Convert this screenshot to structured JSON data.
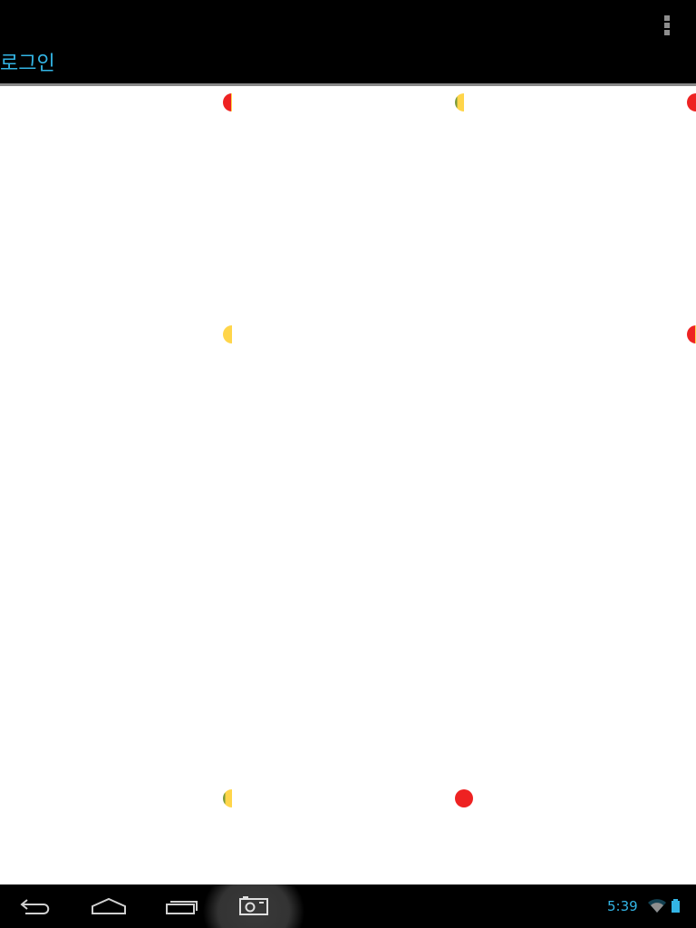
{
  "action_bar": {
    "title": "로그인",
    "overflow_icon": "overflow-menu-icon"
  },
  "content": {
    "colors": {
      "red": "#ee2222",
      "yellow": "#ffd54a"
    },
    "markers": [
      {
        "name": "marker-top-left",
        "style": "split-red-yellow"
      },
      {
        "name": "marker-top-center",
        "style": "yellow-partial"
      },
      {
        "name": "marker-top-right",
        "style": "red"
      },
      {
        "name": "marker-middle-left",
        "style": "yellow"
      },
      {
        "name": "marker-middle-center",
        "style": "yellow-half"
      },
      {
        "name": "marker-middle-right",
        "style": "split-red-yellow"
      },
      {
        "name": "marker-bottom-left",
        "style": "yellow-partial"
      },
      {
        "name": "marker-bottom-center",
        "style": "red"
      }
    ]
  },
  "nav_bar": {
    "buttons": [
      {
        "name": "back-button",
        "icon": "back-icon"
      },
      {
        "name": "home-button",
        "icon": "home-icon"
      },
      {
        "name": "recent-apps-button",
        "icon": "recent-apps-icon"
      },
      {
        "name": "screenshot-button",
        "icon": "camera-icon"
      }
    ],
    "status": {
      "time": "5:39",
      "wifi_icon": "wifi-icon",
      "battery_icon": "battery-icon",
      "accent": "#33b5e5"
    }
  }
}
